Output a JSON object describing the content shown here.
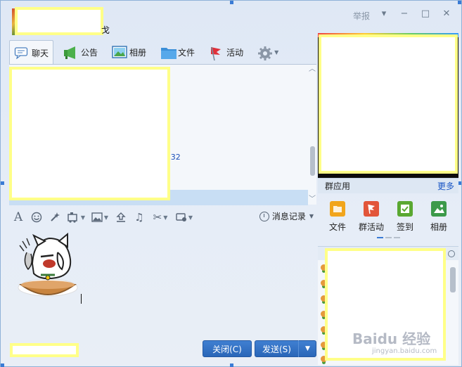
{
  "window": {
    "title_tail": "戈",
    "report_label": "举报",
    "controls": {
      "dropdown": "▾",
      "minimize": "−",
      "maximize": "□",
      "close": "✕"
    }
  },
  "tabs": [
    {
      "label": "聊天",
      "icon": "chat-bubble-icon",
      "active": true
    },
    {
      "label": "公告",
      "icon": "megaphone-icon",
      "active": false
    },
    {
      "label": "相册",
      "icon": "photo-icon",
      "active": false
    },
    {
      "label": "文件",
      "icon": "folder-icon",
      "active": false
    },
    {
      "label": "活动",
      "icon": "flag-icon",
      "active": false
    }
  ],
  "chat": {
    "timestamp_fragment": ":32"
  },
  "input_tools": {
    "history_label": "消息记录"
  },
  "buttons": {
    "close_label": "关闭(C)",
    "send_label": "发送(S)"
  },
  "group_apps": {
    "title": "群应用",
    "more_label": "更多",
    "items": [
      {
        "label": "文件",
        "icon": "file-folder-icon",
        "color": "#f1a51c"
      },
      {
        "label": "群活动",
        "icon": "group-activity-icon",
        "color": "#e2553a"
      },
      {
        "label": "签到",
        "icon": "check-in-icon",
        "color": "#5aa832"
      },
      {
        "label": "相册",
        "icon": "album-icon",
        "color": "#3c9a4a"
      }
    ]
  },
  "watermark": {
    "text": "Baidu 经验",
    "sub": "jingyan.baidu.com"
  },
  "colors": {
    "accent": "#2a66b8",
    "link": "#1a56c4",
    "highlight": "#c8def4"
  }
}
